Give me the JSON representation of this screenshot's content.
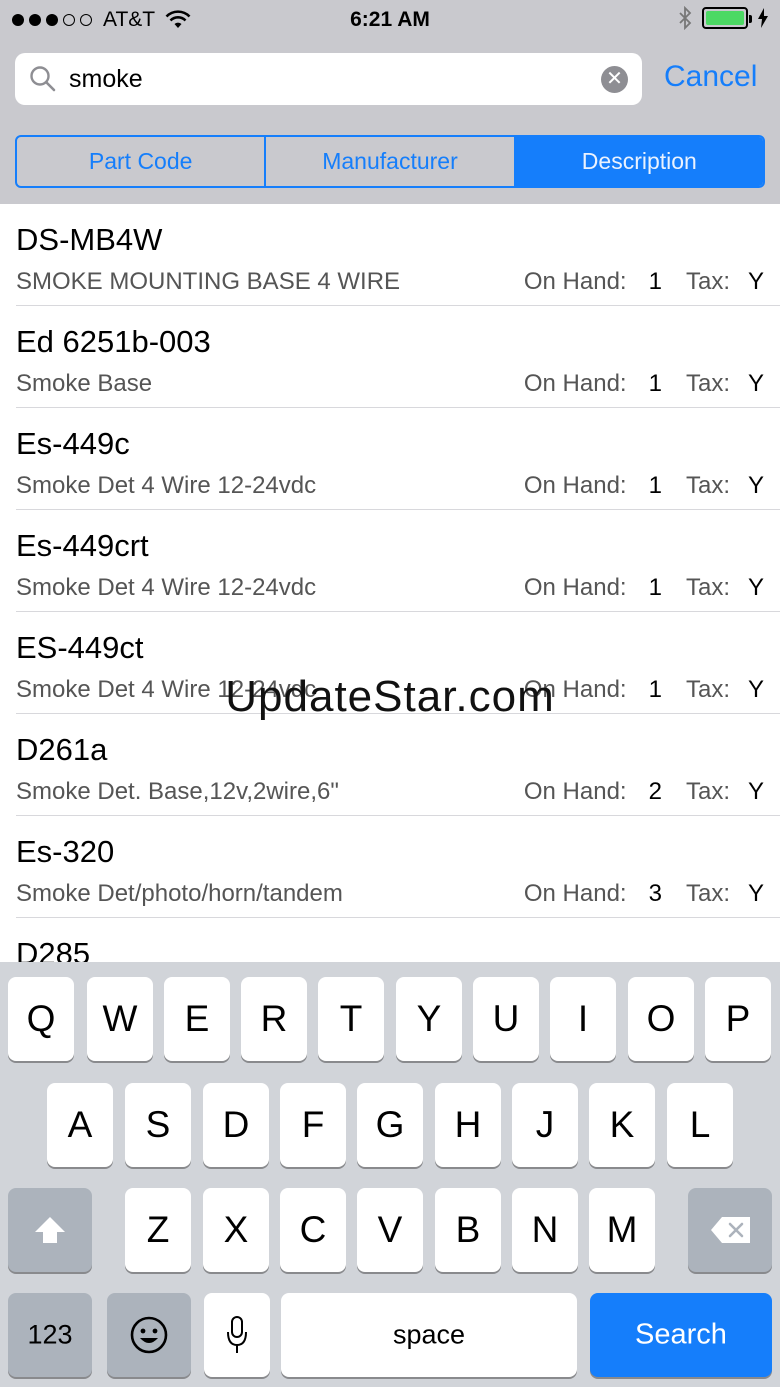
{
  "status_bar": {
    "carrier": "AT&T",
    "time": "6:21 AM",
    "signal_bars_filled": 3,
    "signal_bars_total": 5,
    "battery_level": 1.0
  },
  "search": {
    "value": "smoke",
    "cancel_label": "Cancel"
  },
  "segments": [
    {
      "label": "Part Code",
      "active": false
    },
    {
      "label": "Manufacturer",
      "active": false
    },
    {
      "label": "Description",
      "active": true
    }
  ],
  "list": {
    "on_hand_label": "On Hand:",
    "tax_label": "Tax:",
    "items": [
      {
        "code": "DS-MB4W",
        "desc": "SMOKE MOUNTING BASE 4 WIRE",
        "on_hand": "1",
        "tax": "Y"
      },
      {
        "code": "Ed 6251b-003",
        "desc": "Smoke Base",
        "on_hand": "1",
        "tax": "Y"
      },
      {
        "code": "Es-449c",
        "desc": "Smoke Det 4 Wire 12-24vdc",
        "on_hand": "1",
        "tax": "Y"
      },
      {
        "code": "Es-449crt",
        "desc": "Smoke Det 4 Wire 12-24vdc",
        "on_hand": "1",
        "tax": "Y"
      },
      {
        "code": "ES-449ct",
        "desc": "Smoke Det 4 Wire 12-24vdc",
        "on_hand": "1",
        "tax": "Y"
      },
      {
        "code": "D261a",
        "desc": "Smoke Det. Base,12v,2wire,6\"",
        "on_hand": "2",
        "tax": "Y"
      },
      {
        "code": "Es-320",
        "desc": "Smoke Det/photo/horn/tandem",
        "on_hand": "3",
        "tax": "Y"
      },
      {
        "code": "D285",
        "desc": "",
        "on_hand": "",
        "tax": ""
      }
    ]
  },
  "watermark": "UpdateStar.com",
  "keyboard": {
    "row1": [
      "Q",
      "W",
      "E",
      "R",
      "T",
      "Y",
      "U",
      "I",
      "O",
      "P"
    ],
    "row2": [
      "A",
      "S",
      "D",
      "F",
      "G",
      "H",
      "J",
      "K",
      "L"
    ],
    "row3": [
      "Z",
      "X",
      "C",
      "V",
      "B",
      "N",
      "M"
    ],
    "numbers_label": "123",
    "space_label": "space",
    "search_label": "Search"
  },
  "colors": {
    "accent": "#157efb",
    "battery": "#4cd964"
  }
}
